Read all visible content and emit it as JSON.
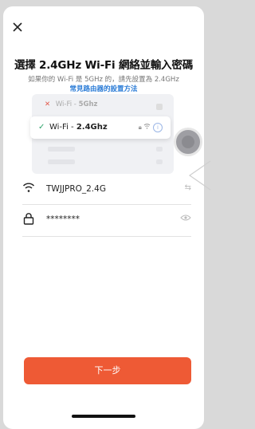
{
  "header": {
    "close_icon": "close-icon"
  },
  "title": "選擇 2.4GHz Wi-Fi 網絡並輸入密碼",
  "subtitle": {
    "text": "如果你的 Wi-Fi 是 5GHz 的，請先設置為 2.4GHz",
    "link": "常見路由器的設置方法"
  },
  "illustration": {
    "row_5g": {
      "prefix": "Wi-Fi - ",
      "band": "5Ghz"
    },
    "row_24g": {
      "prefix": "Wi-Fi - ",
      "band": "2.4Ghz"
    }
  },
  "wifi": {
    "ssid": "TWJJPRO_2.4G",
    "password_masked": "********"
  },
  "actions": {
    "next_label": "下一步"
  },
  "colors": {
    "accent": "#ee5a35",
    "link": "#2a7bd6",
    "check": "#2fa36b",
    "cross": "#e35a4c"
  }
}
